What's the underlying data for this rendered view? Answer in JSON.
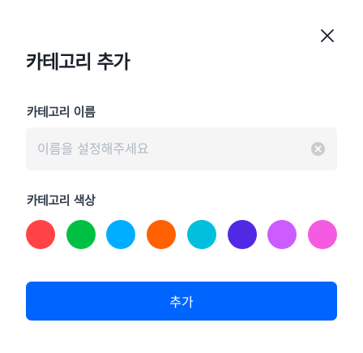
{
  "dialog": {
    "title": "카테고리 추가",
    "close_icon": "close-icon"
  },
  "name_field": {
    "label": "카테고리 이름",
    "value": "",
    "placeholder": "이름을 설정해주세요",
    "clear_icon": "clear-circle-icon"
  },
  "color_field": {
    "label": "카테고리 색상",
    "colors": [
      "#FF4347",
      "#00C043",
      "#00AEFF",
      "#FF6000",
      "#00BFDD",
      "#5129E5",
      "#CC5CFF",
      "#F55BE0"
    ]
  },
  "submit": {
    "label": "추가",
    "color": "#0064FF"
  }
}
